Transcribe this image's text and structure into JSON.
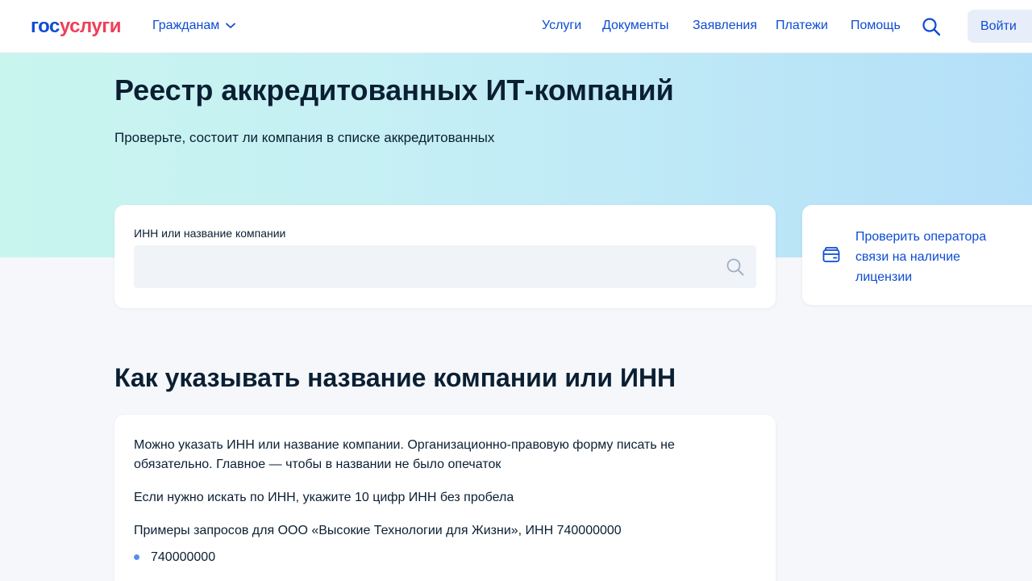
{
  "header": {
    "logo_gos": "гос",
    "logo_uslugi": "услуги",
    "audience": "Гражданам",
    "nav": [
      "Услуги",
      "Документы",
      "Заявления",
      "Платежи",
      "Помощь"
    ],
    "login": "Войти"
  },
  "hero": {
    "title": "Реестр аккредитованных ИТ-компаний",
    "subtitle": "Проверьте, состоит ли компания в списке аккредитованных"
  },
  "search": {
    "label": "ИНН или название компании",
    "value": "",
    "placeholder": ""
  },
  "side_link": {
    "text": "Проверить оператора связи на наличие лицензии"
  },
  "how_to": {
    "title": "Как указывать название компании или ИНН",
    "paragraph1_line1": "Можно указать ИНН или название компании. Организационно-правовую форму писать не",
    "paragraph1_line2": "обязательно. Главное — чтобы в названии не было опечаток",
    "paragraph2": "Если нужно искать по ИНН, укажите 10 цифр ИНН без пробела",
    "paragraph3": "Примеры запросов для ООО «Высокие Технологии для Жизни», ИНН 740000000",
    "examples": [
      "740000000"
    ]
  },
  "colors": {
    "brand_blue": "#0d4cd3",
    "brand_red": "#ee3f58",
    "text": "#0b1f33",
    "bullet": "#5c8ee6"
  }
}
